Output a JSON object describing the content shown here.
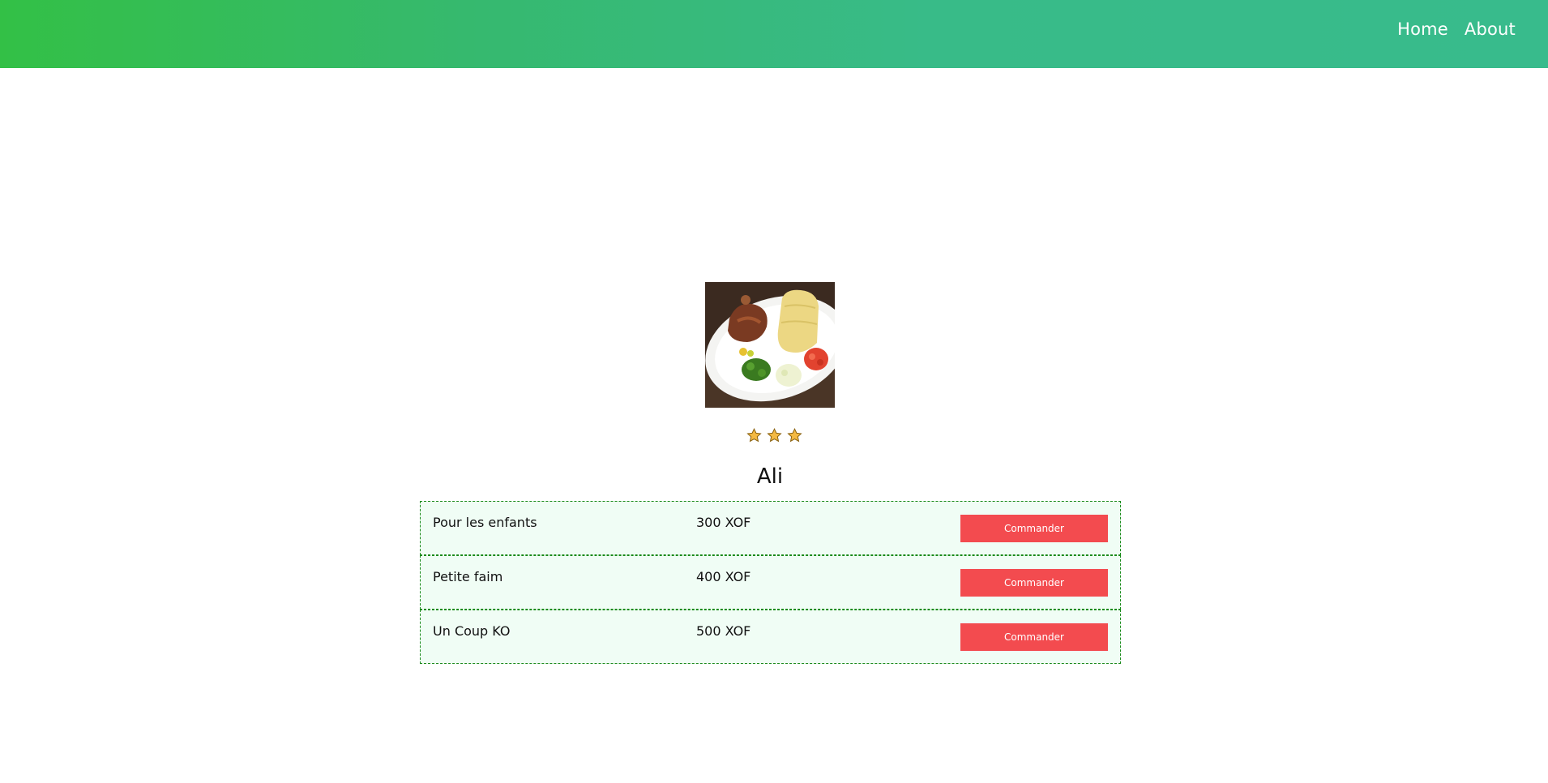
{
  "nav": {
    "home": "Home",
    "about": "About"
  },
  "restaurant": {
    "name": "Ali",
    "rating": 3,
    "rating_max": 3,
    "image_icon": "food-plate-image"
  },
  "menu": [
    {
      "label": "Pour les enfants",
      "price": "300 XOF",
      "button": "Commander"
    },
    {
      "label": "Petite faim",
      "price": "400 XOF",
      "button": "Commander"
    },
    {
      "label": "Un Coup KO",
      "price": "500 XOF",
      "button": "Commander"
    }
  ],
  "colors": {
    "nav_gradient_start": "#33c046",
    "nav_gradient_end": "#38bb8c",
    "button": "#f34b4f",
    "row_bg": "#f0fdf5",
    "row_border": "#1a8a1a",
    "star": "#f4b942"
  }
}
